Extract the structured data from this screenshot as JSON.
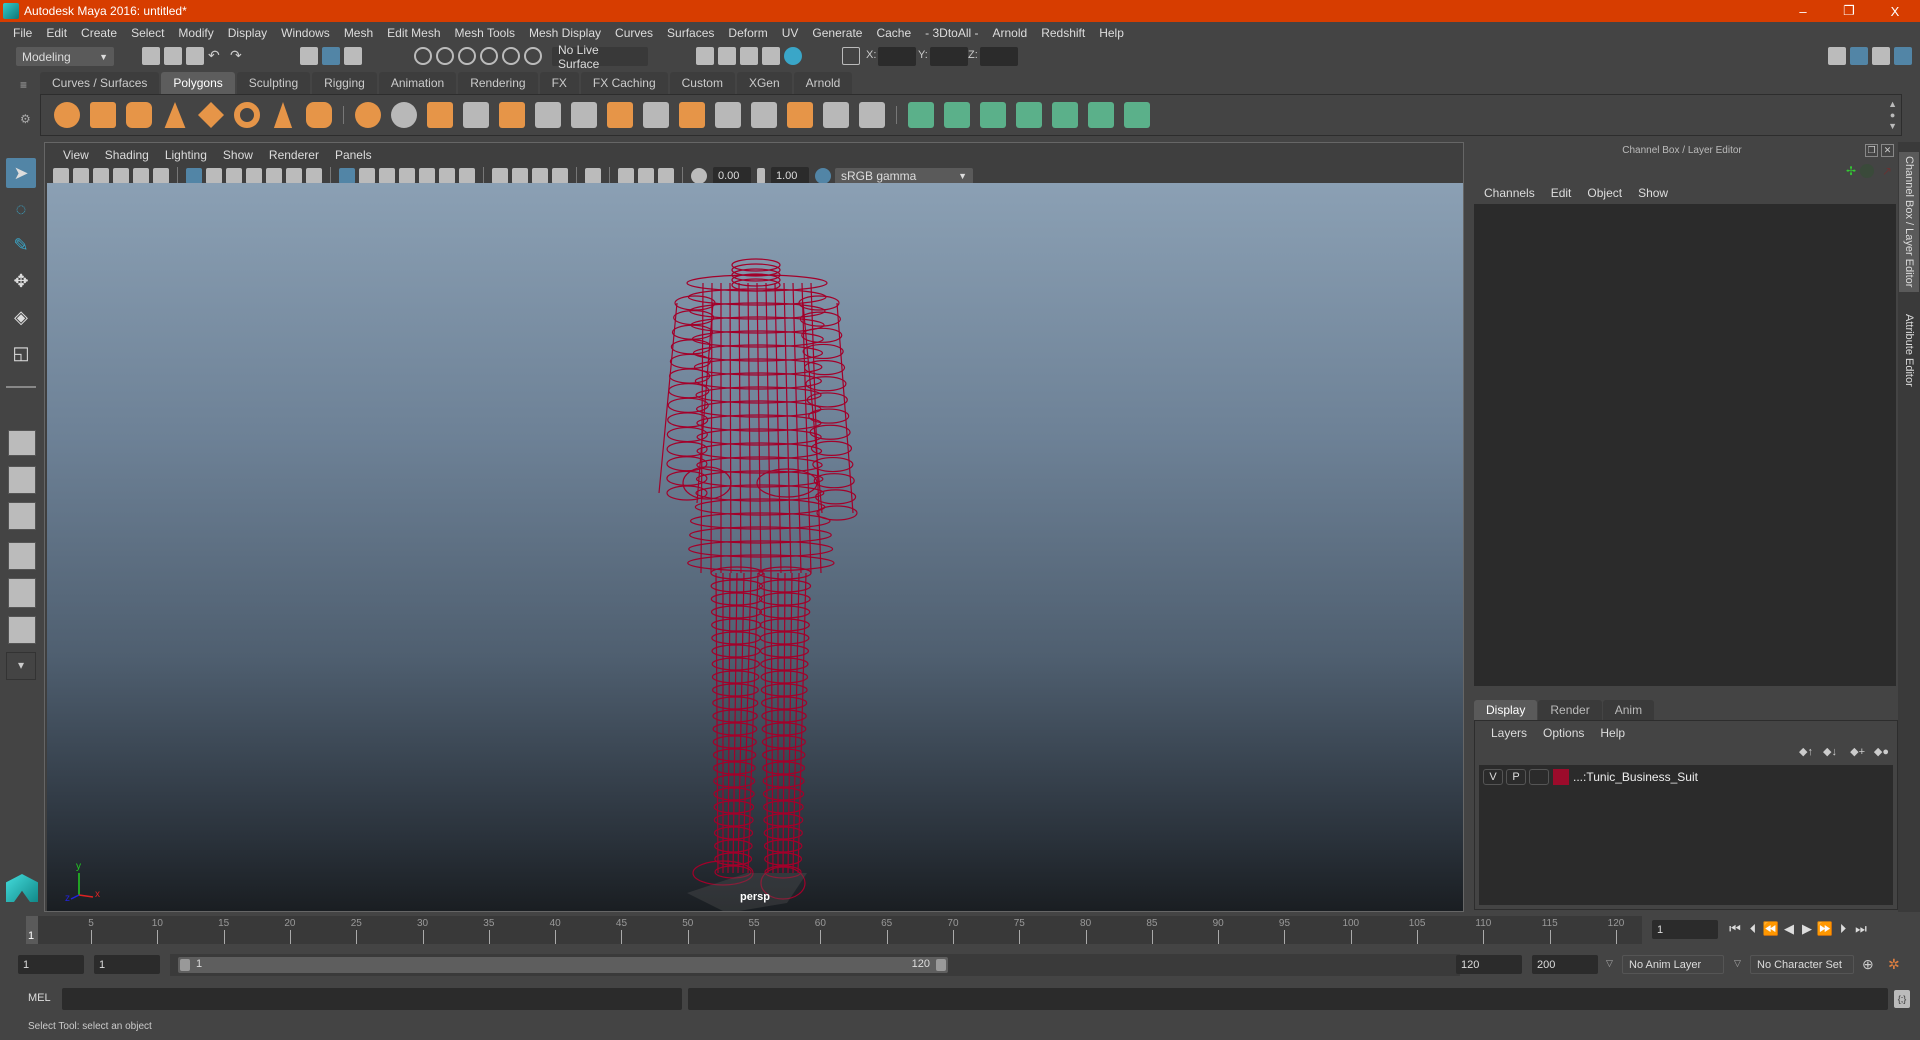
{
  "window": {
    "title": "Autodesk Maya 2016: untitled*",
    "controls": {
      "minimize": "–",
      "restore": "❐",
      "close": "X"
    }
  },
  "menubar": [
    "File",
    "Edit",
    "Create",
    "Select",
    "Modify",
    "Display",
    "Windows",
    "Mesh",
    "Edit Mesh",
    "Mesh Tools",
    "Mesh Display",
    "Curves",
    "Surfaces",
    "Deform",
    "UV",
    "Generate",
    "Cache",
    "- 3DtoAll -",
    "Arnold",
    "Redshift",
    "Help"
  ],
  "statusline": {
    "menuset": "Modeling",
    "live_surface": "No Live Surface",
    "x_label": "X:",
    "y_label": "Y:",
    "z_label": "Z:",
    "x_value": "",
    "y_value": "",
    "z_value": ""
  },
  "shelf": {
    "tabs": [
      "Curves / Surfaces",
      "Polygons",
      "Sculpting",
      "Rigging",
      "Animation",
      "Rendering",
      "FX",
      "FX Caching",
      "Custom",
      "XGen",
      "Arnold"
    ],
    "active_tab": "Polygons",
    "icons": [
      "sphere",
      "cube",
      "cylinder",
      "cone",
      "plane-diamond",
      "torus",
      "pyramid",
      "pipe",
      "combine",
      "separate",
      "mirror",
      "smooth",
      "extrude-box",
      "bevel",
      "multi-cut",
      "bridge",
      "append",
      "extrude",
      "face-center",
      "edge-loop",
      "uv-lines",
      "quad-draw",
      "planar-uv",
      "cylindrical-uv",
      "spherical-uv",
      "automatic-uv",
      "unfold-uv",
      "uv-editor",
      "uv-snapshot"
    ]
  },
  "viewport": {
    "menu": [
      "View",
      "Shading",
      "Lighting",
      "Show",
      "Renderer",
      "Panels"
    ],
    "exposure": "0.00",
    "gamma": "1.00",
    "colorspace": "sRGB gamma",
    "camera_label": "persp",
    "axis": {
      "x": "x",
      "y": "y",
      "z": "z"
    },
    "wireframe_color": "#a3002a"
  },
  "channel_box": {
    "title": "Channel Box / Layer Editor",
    "menu": [
      "Channels",
      "Edit",
      "Object",
      "Show"
    ]
  },
  "layer_editor": {
    "tabs": [
      "Display",
      "Render",
      "Anim"
    ],
    "active_tab": "Display",
    "menu": [
      "Layers",
      "Options",
      "Help"
    ],
    "layers": [
      {
        "visible": "V",
        "playback": "P",
        "ref": "",
        "color": "#9b0b2b",
        "name": "...:Tunic_Business_Suit"
      }
    ]
  },
  "side_tabs": [
    "Channel Box / Layer Editor",
    "Attribute Editor"
  ],
  "timeslider": {
    "ticks": [
      5,
      10,
      15,
      20,
      25,
      30,
      35,
      40,
      45,
      50,
      55,
      60,
      65,
      70,
      75,
      80,
      85,
      90,
      95,
      100,
      105,
      110,
      115,
      120
    ],
    "current_frame_marker": "1",
    "current_frame": "1",
    "range": [
      1,
      120
    ]
  },
  "range_slider": {
    "start_frame": "1",
    "playback_start": "1",
    "slider_start": "1",
    "slider_end": "120",
    "playback_end": "120",
    "end_frame": "200",
    "anim_layer": "No Anim Layer",
    "character_set": "No Character Set"
  },
  "command_line": {
    "label": "MEL",
    "input": "",
    "result": ""
  },
  "help_line": "Select Tool: select an object",
  "colors": {
    "titlebar": "#d73d00",
    "accent": "#5285a6",
    "panel": "#444444"
  }
}
